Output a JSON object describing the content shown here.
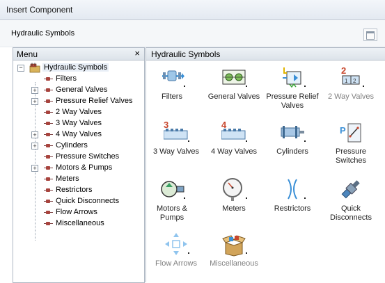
{
  "window": {
    "title": "Insert Component"
  },
  "header": {
    "title": "Hydraulic Symbols"
  },
  "menu": {
    "title": "Menu",
    "close_label": "×",
    "root": {
      "label": "Hydraulic Symbols"
    },
    "items": [
      {
        "label": "Filters"
      },
      {
        "label": "General Valves"
      },
      {
        "label": "Pressure Relief Valves"
      },
      {
        "label": "2 Way Valves"
      },
      {
        "label": "3 Way Valves"
      },
      {
        "label": "4 Way Valves"
      },
      {
        "label": "Cylinders"
      },
      {
        "label": "Pressure Switches"
      },
      {
        "label": "Motors & Pumps"
      },
      {
        "label": "Meters"
      },
      {
        "label": "Restrictors"
      },
      {
        "label": "Quick Disconnects"
      },
      {
        "label": "Flow Arrows"
      },
      {
        "label": "Miscellaneous"
      }
    ],
    "expand_glyph": "+",
    "collapse_glyph": "−"
  },
  "panel": {
    "title": "Hydraulic Symbols",
    "items": [
      {
        "label": "Filters"
      },
      {
        "label": "General Valves"
      },
      {
        "label": "Pressure Relief Valves"
      },
      {
        "label": "2 Way Valves",
        "badge": "2"
      },
      {
        "label": "3 Way Valves",
        "badge": "3"
      },
      {
        "label": "4 Way Valves",
        "badge": "4"
      },
      {
        "label": "Cylinders"
      },
      {
        "label": "Pressure Switches",
        "badge": "P"
      },
      {
        "label": "Motors & Pumps"
      },
      {
        "label": "Meters"
      },
      {
        "label": "Restrictors"
      },
      {
        "label": "Quick Disconnects"
      },
      {
        "label": "Flow Arrows"
      },
      {
        "label": "Miscellaneous"
      }
    ]
  },
  "colors": {
    "accent_blue": "#3a8fd6",
    "badge_red": "#c8462c"
  }
}
